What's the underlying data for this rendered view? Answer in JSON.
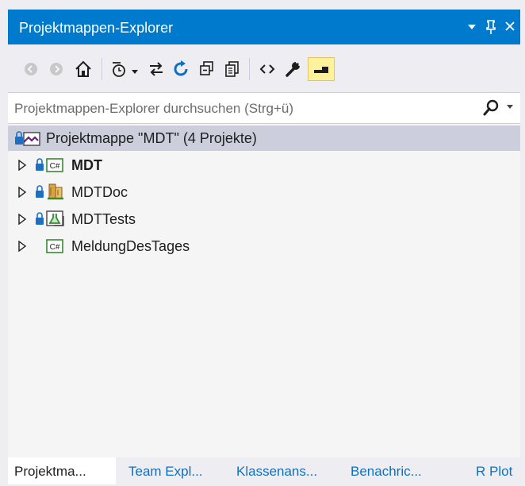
{
  "panel": {
    "title": "Projektmappen-Explorer",
    "title_buttons": [
      "dropdown-arrow-icon",
      "pin-icon",
      "close-icon"
    ]
  },
  "toolbar": {
    "buttons": [
      "back-icon",
      "forward-icon",
      "home-icon",
      "pending-changes-icon",
      "sync-icon",
      "refresh-icon",
      "collapse-all-icon",
      "show-all-files-icon",
      "code-view-icon",
      "properties-wrench-icon",
      "preview-selected-icon"
    ]
  },
  "search": {
    "placeholder": "Projektmappen-Explorer durchsuchen (Strg+ü)"
  },
  "tree": {
    "solution": "Projektmappe \"MDT\" (4 Projekte)",
    "projects": [
      {
        "label": "MDT",
        "bold": true,
        "icon": "csharp-project-icon",
        "locked": true
      },
      {
        "label": "MDTDoc",
        "bold": false,
        "icon": "documentation-project-icon",
        "locked": true
      },
      {
        "label": "MDTTests",
        "bold": false,
        "icon": "test-project-icon",
        "locked": true
      },
      {
        "label": "MeldungDesTages",
        "bold": false,
        "icon": "csharp-project-icon",
        "locked": false
      }
    ]
  },
  "bottom_tabs": [
    "Projektma...",
    "Team Expl...",
    "Klassenans...",
    "Benachric...",
    "R Plot"
  ],
  "colors": {
    "accent": "#007acc",
    "selection": "#cccedb",
    "tab_link": "#0e70c0"
  }
}
